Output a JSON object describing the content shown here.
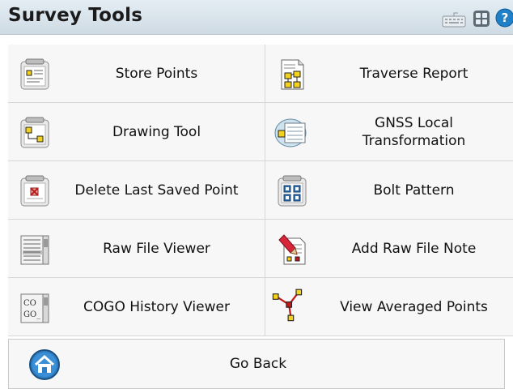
{
  "header": {
    "title": "Survey Tools"
  },
  "tiles": [
    {
      "label": "Store Points",
      "icon": "store-points-icon"
    },
    {
      "label": "Traverse Report",
      "icon": "traverse-report-icon"
    },
    {
      "label": "Drawing Tool",
      "icon": "drawing-tool-icon"
    },
    {
      "label": "GNSS Local Transformation",
      "icon": "gnss-transformation-icon"
    },
    {
      "label": "Delete Last Saved Point",
      "icon": "delete-point-icon"
    },
    {
      "label": "Bolt Pattern",
      "icon": "bolt-pattern-icon"
    },
    {
      "label": "Raw File Viewer",
      "icon": "raw-file-viewer-icon"
    },
    {
      "label": "Add Raw File Note",
      "icon": "add-note-icon"
    },
    {
      "label": "COGO History Viewer",
      "icon": "cogo-history-icon"
    },
    {
      "label": "View Averaged Points",
      "icon": "averaged-points-icon"
    }
  ],
  "icon_text": {
    "cogo": "CO",
    "cogo2": "GO_"
  },
  "footer": {
    "go_back": "Go Back"
  }
}
